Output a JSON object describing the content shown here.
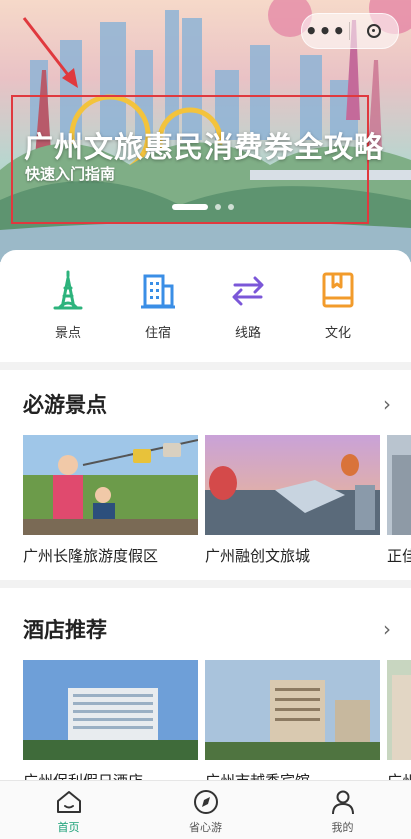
{
  "capsule": {
    "more": "•••"
  },
  "banner": {
    "title": "广州文旅惠民消费券全攻略",
    "subtitle": "快速入门指南",
    "slide_count": 3,
    "active_slide": 1
  },
  "categories": [
    {
      "label": "景点",
      "icon": "tower-icon",
      "color": "#2db37c"
    },
    {
      "label": "住宿",
      "icon": "building-icon",
      "color": "#3a8ee6"
    },
    {
      "label": "线路",
      "icon": "route-arrows-icon",
      "color": "#7b57d8"
    },
    {
      "label": "文化",
      "icon": "book-icon",
      "color": "#f29b2b"
    }
  ],
  "attractions": {
    "title": "必游景点",
    "chevron": "›",
    "items": [
      {
        "name": "广州长隆旅游度假区"
      },
      {
        "name": "广州融创文旅城"
      },
      {
        "name": "正佳"
      }
    ]
  },
  "hotels": {
    "title": "酒店推荐",
    "chevron": "›",
    "items": [
      {
        "name": "广州保利假日酒店"
      },
      {
        "name": "广州市越秀宾馆"
      },
      {
        "name": "广州"
      }
    ]
  },
  "tabbar": {
    "active_color": "#1aa077",
    "tabs": [
      {
        "label": "首页",
        "icon": "home-icon",
        "active": true
      },
      {
        "label": "省心游",
        "icon": "compass-icon",
        "active": false
      },
      {
        "label": "我的",
        "icon": "user-icon",
        "active": false
      }
    ]
  }
}
